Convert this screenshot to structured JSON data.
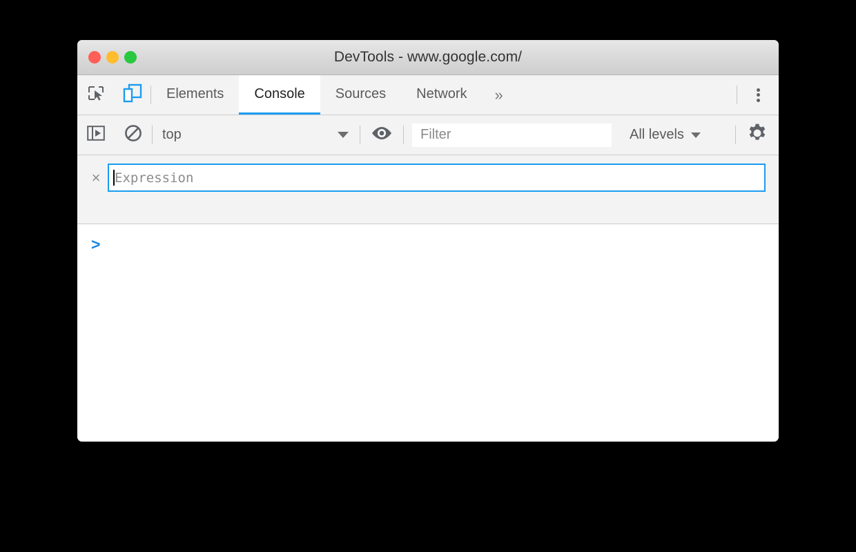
{
  "window": {
    "title": "DevTools - www.google.com/",
    "traffic_lights": [
      {
        "name": "close",
        "color": "#ff5f57"
      },
      {
        "name": "minimize",
        "color": "#ffbd2e"
      },
      {
        "name": "maximize",
        "color": "#28c840"
      }
    ]
  },
  "tabbar": {
    "inspect_icon": "inspect-element-icon",
    "device_icon": "device-toolbar-icon",
    "tabs": [
      {
        "label": "Elements",
        "active": false
      },
      {
        "label": "Console",
        "active": true
      },
      {
        "label": "Sources",
        "active": false
      },
      {
        "label": "Network",
        "active": false
      }
    ],
    "more_tabs_label": "»",
    "more_tabs_icon": "chevron-double-right-icon",
    "menu_icon": "kebab-menu-icon"
  },
  "console_toolbar": {
    "sidebar_toggle_icon": "console-sidebar-icon",
    "clear_console_icon": "clear-console-icon",
    "context": {
      "selected": "top",
      "options": [
        "top"
      ],
      "caret_icon": "chevron-down-icon"
    },
    "live_expression_icon": "eye-icon",
    "filter": {
      "value": "",
      "placeholder": "Filter"
    },
    "levels": {
      "selected": "All levels",
      "options": [
        "All levels"
      ],
      "caret_icon": "chevron-down-icon"
    },
    "settings_icon": "gear-icon"
  },
  "live_expression": {
    "close_label": "×",
    "close_icon": "close-icon",
    "value": "",
    "placeholder": "Expression",
    "focused": true,
    "accent_color": "#1a9cf0"
  },
  "console_output": {
    "prompt": ">",
    "prompt_color": "#1a87e0",
    "messages": []
  }
}
